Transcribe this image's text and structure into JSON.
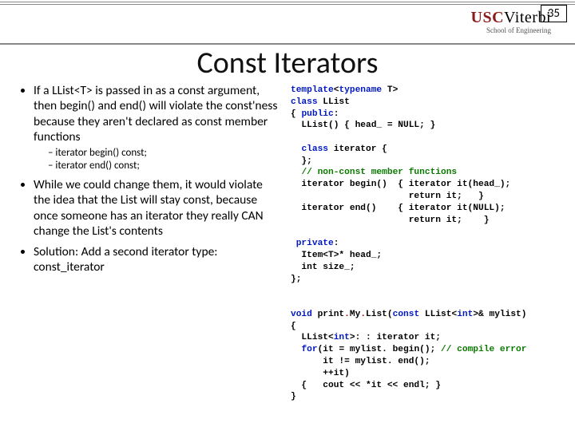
{
  "page_number": "35",
  "logo": {
    "usc": "USC",
    "viterbi": "Viterbi",
    "sub": "School of Engineering"
  },
  "title": "Const Iterators",
  "left": {
    "b1": "If a LList<T> is passed in as a const argument, then begin() and end() will violate the const'ness because they aren't declared as const member functions",
    "d1": "iterator begin() const;",
    "d2": "iterator end() const;",
    "b2": "While we could change them, it would violate the idea that the List will stay const, because once someone has an iterator they really CAN change the List's contents",
    "b3": "Solution:  Add a second iterator type:  const_iterator"
  },
  "code": {
    "l01a": "template",
    "l01b": "<",
    "l01c": "typename",
    "l01d": " T>",
    "l02a": "class",
    "l02b": " LList",
    "l03a": "{ ",
    "l03b": "public",
    "l03c": ":",
    "l04": "  LList() { head_ = NULL; }",
    "l05": "",
    "l06a": "  ",
    "l06b": "class",
    "l06c": " iterator {",
    "l07": "  };",
    "l08a": "  ",
    "l08b": "// non-const member functions",
    "l09": "  iterator begin()  { iterator it(head_);",
    "l10": "                      return it;   }",
    "l11": "  iterator end()    { iterator it(NULL);",
    "l12": "                      return it;    }",
    "l13": "",
    "l14a": " ",
    "l14b": "private",
    "l14c": ":",
    "l15": "  Item<T>* head_;",
    "l16": "  int size_;",
    "l17": "};",
    "l18": "",
    "l19": "",
    "l20a": "void",
    "l20b": " print",
    "l20c": ".",
    "l20d": "My",
    "l20e": ".",
    "l20f": "List(",
    "l20g": "const",
    "l20h": " LList<",
    "l20i": "int",
    "l20j": ">& mylist)",
    "l21": "{",
    "l22a": "  LList<",
    "l22b": "int",
    "l22c": ">: : iterator it;",
    "l23a": "  ",
    "l23b": "for",
    "l23c": "(it = mylist. begin(); ",
    "l23d": "// compile error",
    "l24": "      it != mylist. end();",
    "l25": "      ++it)",
    "l26": "  {   cout << *it << endl; }",
    "l27": "}"
  }
}
